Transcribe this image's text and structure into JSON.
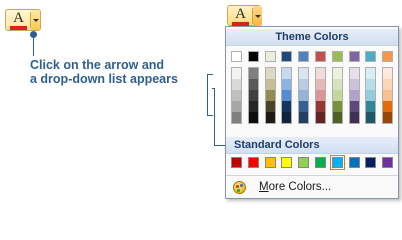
{
  "annotation": {
    "text": "Click on the arrow and\na drop-down list appears"
  },
  "font_color_button": {
    "glyph": "A",
    "current_color": "#e02020",
    "accent_border": "#c9a85a",
    "icon": "font-color-icon",
    "arrow_icon": "dropdown-arrow-icon"
  },
  "dropdown": {
    "theme_header": "Theme Colors",
    "standard_header": "Standard Colors",
    "more_colors_label": "More Colors...",
    "more_colors_icon": "color-palette-icon",
    "theme_colors": [
      "#ffffff",
      "#000000",
      "#eeece1",
      "#1f497d",
      "#4f81bd",
      "#c0504d",
      "#9bbb59",
      "#8064a2",
      "#4bacc6",
      "#f79646"
    ],
    "theme_shades": [
      [
        "#f2f2f2",
        "#d9d9d9",
        "#bfbfbf",
        "#a6a6a6",
        "#808080"
      ],
      [
        "#7f7f7f",
        "#595959",
        "#404040",
        "#262626",
        "#0d0d0d"
      ],
      [
        "#ddd9c3",
        "#c4bd97",
        "#938953",
        "#4a452a",
        "#1d1b11"
      ],
      [
        "#c6d9f0",
        "#8db3e2",
        "#548dd4",
        "#17365d",
        "#0f243e"
      ],
      [
        "#dbe5f1",
        "#b8cce4",
        "#95b3d7",
        "#366092",
        "#244061"
      ],
      [
        "#f2dcdb",
        "#e5b9b7",
        "#d99694",
        "#953734",
        "#632423"
      ],
      [
        "#ebf1dd",
        "#d7e3bc",
        "#c3d69b",
        "#76923c",
        "#4f6128"
      ],
      [
        "#e5e0ec",
        "#ccc1d9",
        "#b2a2c7",
        "#5f497a",
        "#3f3151"
      ],
      [
        "#dbeef3",
        "#b7dde8",
        "#92cddc",
        "#31859b",
        "#205867"
      ],
      [
        "#fdeada",
        "#fbd5b5",
        "#fac08f",
        "#e36c09",
        "#974806"
      ]
    ],
    "standard_colors": [
      "#c00000",
      "#ff0000",
      "#ffc000",
      "#ffff00",
      "#92d050",
      "#00b050",
      "#00b0f0",
      "#0070c0",
      "#002060",
      "#7030a0"
    ],
    "selected_standard_index": 6
  }
}
